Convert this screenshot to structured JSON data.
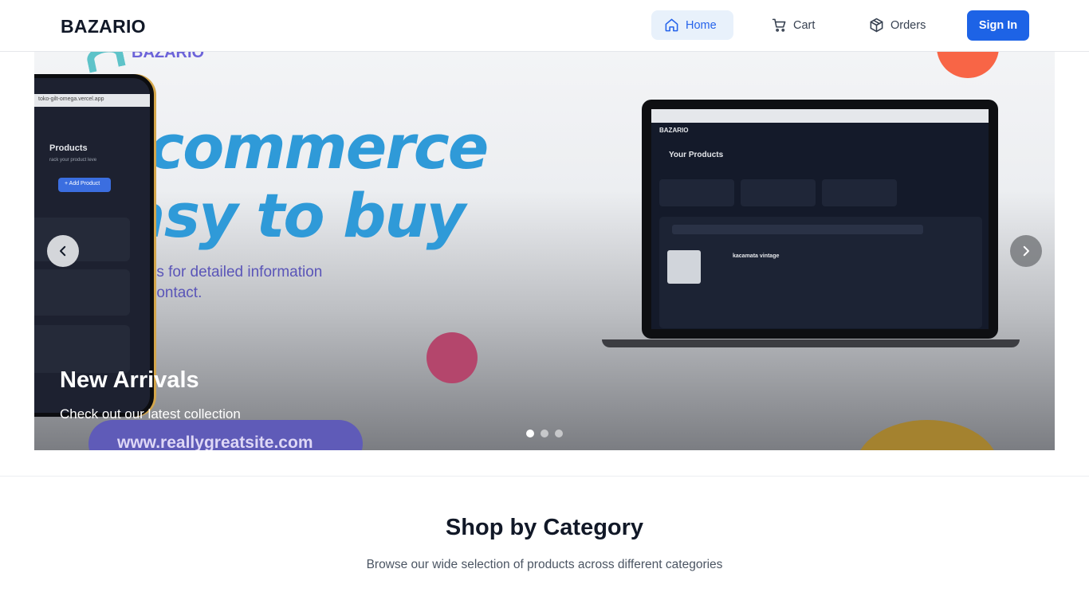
{
  "header": {
    "brand": "BAZARIO",
    "nav": [
      {
        "label": "Home",
        "icon": "home-icon",
        "active": true
      },
      {
        "label": "Cart",
        "icon": "cart-icon",
        "active": false
      },
      {
        "label": "Orders",
        "icon": "package-icon",
        "active": false
      }
    ],
    "sign_in_label": "Sign In"
  },
  "hero": {
    "slide_title": "New Arrivals",
    "slide_subtitle": "Check out our latest collection",
    "slide_count": 3,
    "active_slide": 1,
    "image": {
      "brand_mark": "BAZARIO",
      "headline_line1": "e-commerce",
      "headline_line2": "easy to buy",
      "contact_line1": "Contact us for detailed information",
      "contact_line2": "you can contact.",
      "url": "www.reallygreatsite.com",
      "phone_url": "toko-gilt-omega.vercel.app",
      "phone_heading": "Products",
      "phone_subheading": "rack your product leve",
      "phone_button": "+ Add Product",
      "laptop_brand": "BAZARIO",
      "laptop_heading": "Your Products",
      "laptop_product": "kacamata vintage"
    }
  },
  "category_section": {
    "title": "Shop by Category",
    "subtitle": "Browse our wide selection of products across different categories"
  },
  "colors": {
    "primary": "#1d63e6",
    "active_nav_bg": "#e8f1fb",
    "headline_blue": "#2f9ad8"
  }
}
